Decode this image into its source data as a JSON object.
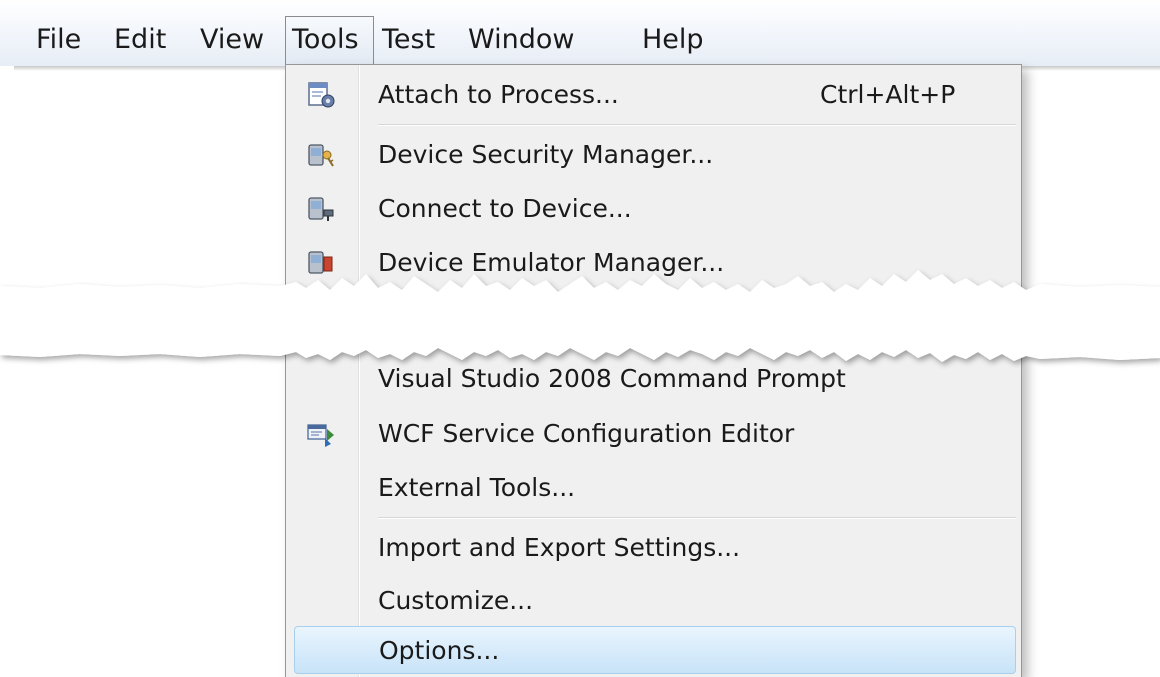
{
  "menubar": {
    "items": [
      {
        "label": "File"
      },
      {
        "label": "Edit"
      },
      {
        "label": "View"
      },
      {
        "label": "Tools"
      },
      {
        "label": "Test"
      },
      {
        "label": "Window"
      },
      {
        "label": "Help"
      }
    ],
    "active": "Tools"
  },
  "tools_menu": {
    "top_items": [
      {
        "label": "Attach to Process...",
        "shortcut": "Ctrl+Alt+P",
        "icon": "attach-process-icon"
      },
      {
        "label": "Device Security Manager...",
        "icon": "device-security-icon"
      },
      {
        "label": "Connect to Device...",
        "icon": "connect-device-icon"
      },
      {
        "label": "Device Emulator Manager...",
        "icon": "device-emulator-icon"
      }
    ],
    "bottom_items": [
      {
        "label": "Visual Studio 2008 Command Prompt"
      },
      {
        "label": "WCF Service Configuration Editor",
        "icon": "wcf-config-icon"
      },
      {
        "label": "External Tools..."
      },
      {
        "label": "Import and Export Settings..."
      },
      {
        "label": "Customize..."
      },
      {
        "label": "Options...",
        "highlighted": true
      }
    ]
  },
  "colors": {
    "highlight_border": "#a8d0ee",
    "highlight_fill": "#d8ecfb",
    "menu_background": "#f0f0f0"
  }
}
